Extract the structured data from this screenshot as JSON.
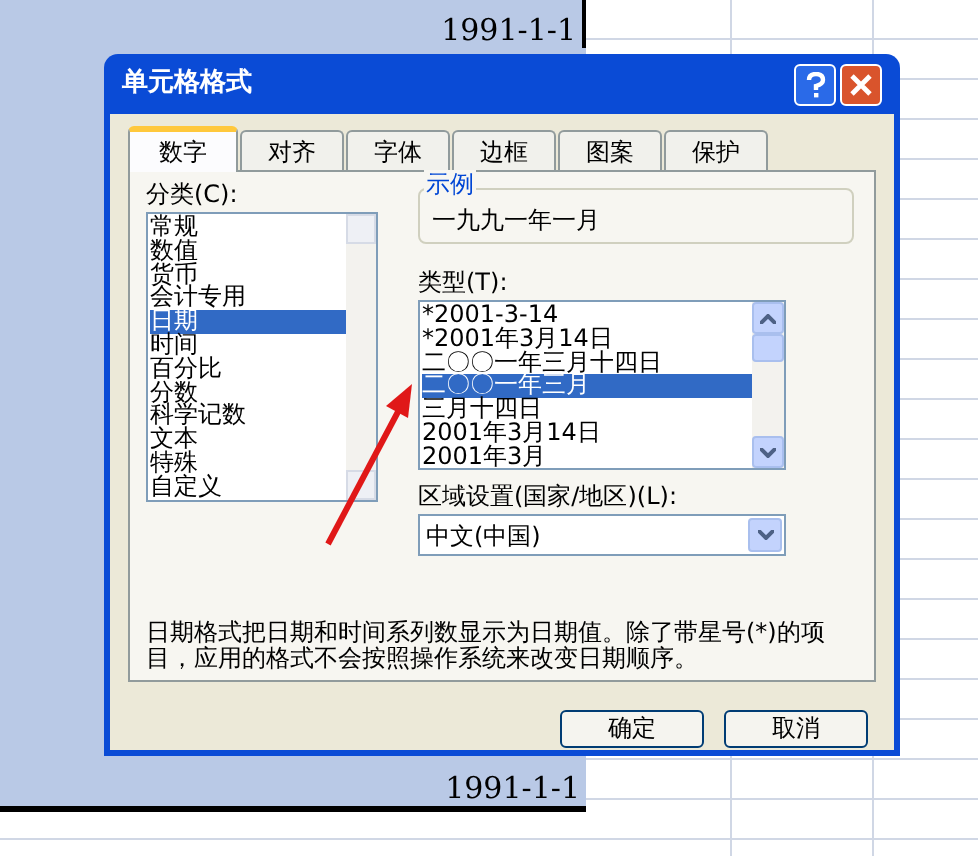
{
  "sheet": {
    "cells": [
      {
        "text": "1991-1-1"
      },
      {
        "text": "1991-1-1"
      }
    ]
  },
  "dialog": {
    "title": "单元格格式",
    "tabs": [
      {
        "label": "数字",
        "selected": true
      },
      {
        "label": "对齐",
        "selected": false
      },
      {
        "label": "字体",
        "selected": false
      },
      {
        "label": "边框",
        "selected": false
      },
      {
        "label": "图案",
        "selected": false
      },
      {
        "label": "保护",
        "selected": false
      }
    ],
    "category": {
      "label": "分类(C):",
      "items": [
        {
          "label": "常规",
          "selected": false
        },
        {
          "label": "数值",
          "selected": false
        },
        {
          "label": "货币",
          "selected": false
        },
        {
          "label": "会计专用",
          "selected": false
        },
        {
          "label": "日期",
          "selected": true
        },
        {
          "label": "时间",
          "selected": false
        },
        {
          "label": "百分比",
          "selected": false
        },
        {
          "label": "分数",
          "selected": false
        },
        {
          "label": "科学记数",
          "selected": false
        },
        {
          "label": "文本",
          "selected": false
        },
        {
          "label": "特殊",
          "selected": false
        },
        {
          "label": "自定义",
          "selected": false
        }
      ]
    },
    "sample": {
      "label": "示例",
      "value": "一九九一年一月"
    },
    "type": {
      "label": "类型(T):",
      "items": [
        {
          "label": "*2001-3-14",
          "selected": false
        },
        {
          "label": "*2001年3月14日",
          "selected": false
        },
        {
          "label": "二〇〇一年三月十四日",
          "selected": false
        },
        {
          "label": "二〇〇一年三月",
          "selected": true
        },
        {
          "label": "三月十四日",
          "selected": false
        },
        {
          "label": "2001年3月14日",
          "selected": false
        },
        {
          "label": "2001年3月",
          "selected": false
        }
      ]
    },
    "locale": {
      "label": "区域设置(国家/地区)(L):",
      "value": "中文(中国)"
    },
    "description": "日期格式把日期和时间系列数显示为日期值。除了带星号(*)的项目，应用的格式不会按照操作系统来改变日期顺序。",
    "buttons": [
      "确定",
      "取消"
    ]
  }
}
